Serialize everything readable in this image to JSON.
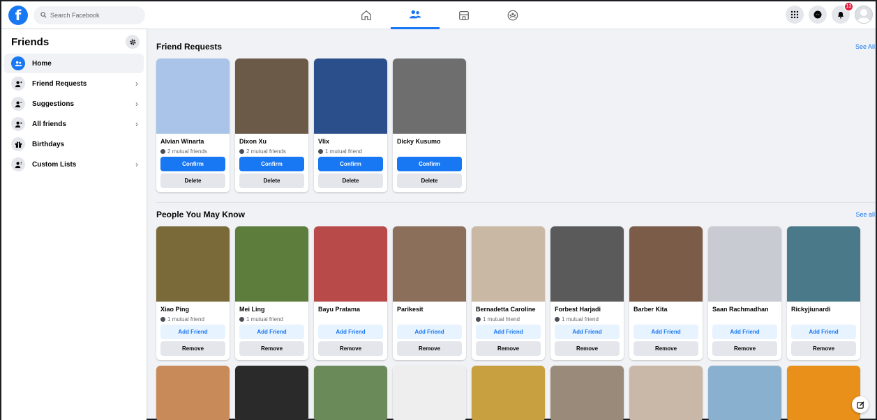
{
  "search": {
    "placeholder": "Search Facebook"
  },
  "nav": {
    "badge_count": "13"
  },
  "sidebar": {
    "title": "Friends",
    "items": [
      {
        "label": "Home",
        "icon": "friends-icon",
        "chevron": false,
        "active": true
      },
      {
        "label": "Friend Requests",
        "icon": "add-friend-icon",
        "chevron": true,
        "active": false
      },
      {
        "label": "Suggestions",
        "icon": "suggestions-icon",
        "chevron": true,
        "active": false
      },
      {
        "label": "All friends",
        "icon": "list-friends-icon",
        "chevron": true,
        "active": false
      },
      {
        "label": "Birthdays",
        "icon": "gift-icon",
        "chevron": false,
        "active": false
      },
      {
        "label": "Custom Lists",
        "icon": "custom-list-icon",
        "chevron": true,
        "active": false
      }
    ]
  },
  "requests": {
    "title": "Friend Requests",
    "see_all": "See All",
    "confirm_label": "Confirm",
    "delete_label": "Delete",
    "cards": [
      {
        "name": "Alvian Winarta",
        "mutual": "2 mutual friends",
        "color": "#a9c4e8"
      },
      {
        "name": "Dixon Xu",
        "mutual": "2 mutual friends",
        "color": "#6b5a48"
      },
      {
        "name": "Vlix",
        "mutual": "1 mutual friend",
        "color": "#2a4f8a"
      },
      {
        "name": "Dicky Kusumo",
        "mutual": "",
        "color": "#6e6e6e"
      }
    ]
  },
  "people": {
    "title": "People You May Know",
    "see_all": "See all",
    "add_label": "Add Friend",
    "remove_label": "Remove",
    "cards": [
      {
        "name": "Xiao Ping",
        "mutual": "1 mutual friend",
        "color": "#7a6a3a"
      },
      {
        "name": "Mei Ling",
        "mutual": "1 mutual friend",
        "color": "#5d7d3c"
      },
      {
        "name": "Bayu Pratama",
        "mutual": "",
        "color": "#b94a4a"
      },
      {
        "name": "Parikesit",
        "mutual": "",
        "color": "#8b6f5a"
      },
      {
        "name": "Bernadetta Caroline",
        "mutual": "1 mutual friend",
        "color": "#c9b8a4"
      },
      {
        "name": "Forbest Harjadi",
        "mutual": "1 mutual friend",
        "color": "#5a5a5a"
      },
      {
        "name": "Barber Kita",
        "mutual": "",
        "color": "#7a5c48"
      },
      {
        "name": "Saan Rachmadhan",
        "mutual": "",
        "color": "#c8cbd1"
      },
      {
        "name": "Rickyjiunardi",
        "mutual": "",
        "color": "#4a7a8a"
      }
    ],
    "row3_colors": [
      "#c98a5a",
      "#2a2a2a",
      "#6a8a5a",
      "#eeeeee",
      "#c9a040",
      "#9a8a7a",
      "#c9b8a8",
      "#8ab0d0",
      "#e8901a"
    ]
  }
}
